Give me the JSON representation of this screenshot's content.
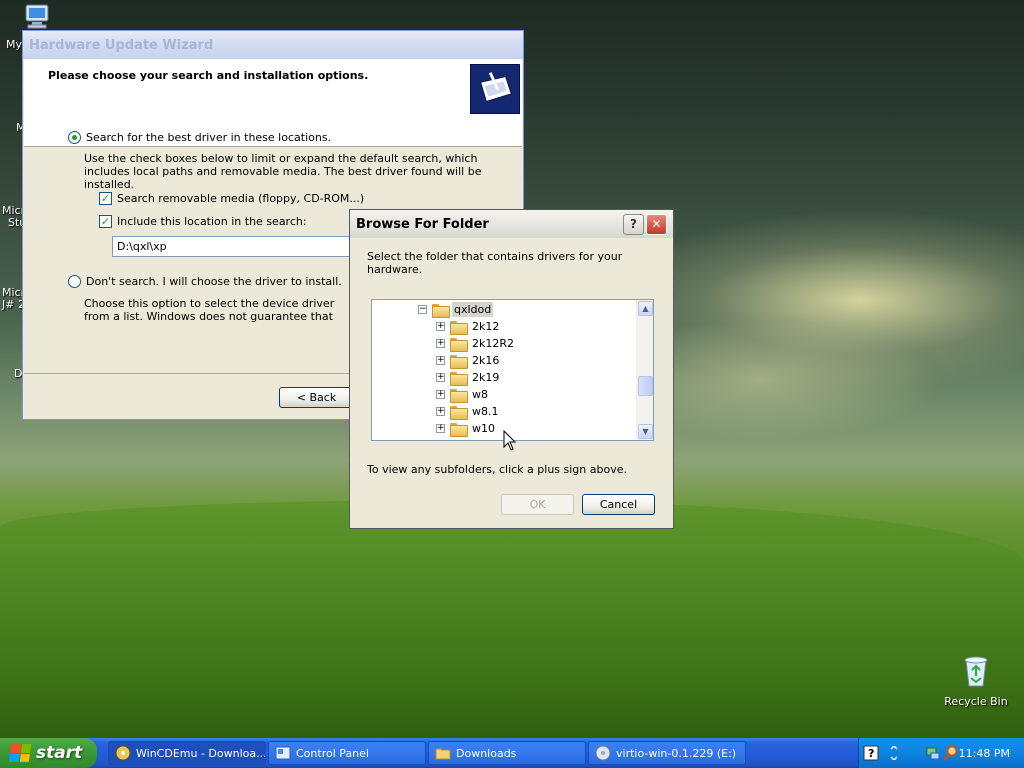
{
  "desktop": {
    "my_computer_label": "My",
    "stubs": [
      "M",
      "Micr",
      "Stu",
      "Micr",
      "J# 2",
      "D"
    ],
    "recycle_bin_label": "Recycle Bin"
  },
  "wizard": {
    "title": "Hardware Update Wizard",
    "header": "Please choose your search and installation options.",
    "option_search_label": "Search for the best driver in these locations.",
    "option_search_desc": "Use the check boxes below to limit or expand the default search, which includes local paths and removable media. The best driver found will be installed.",
    "check_removable_label": "Search removable media (floppy, CD-ROM...)",
    "check_include_label": "Include this location in the search:",
    "location_value": "D:\\qxl\\xp",
    "option_dontsearch_label": "Don't search. I will choose the driver to install.",
    "option_dontsearch_desc": "Choose this option to select the device driver from a list. Windows does not guarantee that the driver you choose will be the best match for your hardware.",
    "back_button": "< Back"
  },
  "browse": {
    "title": "Browse For Folder",
    "help_button": "?",
    "close_button": "✕",
    "instruction": "Select the folder that contains drivers for your hardware.",
    "tree": {
      "root": "qxldod",
      "children": [
        "2k12",
        "2k12R2",
        "2k16",
        "2k19",
        "w8",
        "w8.1",
        "w10"
      ]
    },
    "hint": "To view any subfolders, click a plus sign above.",
    "ok_button": "OK",
    "cancel_button": "Cancel"
  },
  "taskbar": {
    "start_label": "start",
    "tasks": [
      "WinCDEmu - Downloa...",
      "Control Panel",
      "Downloads",
      "virtio-win-0.1.229 (E:)"
    ],
    "clock": "11:48 PM"
  }
}
